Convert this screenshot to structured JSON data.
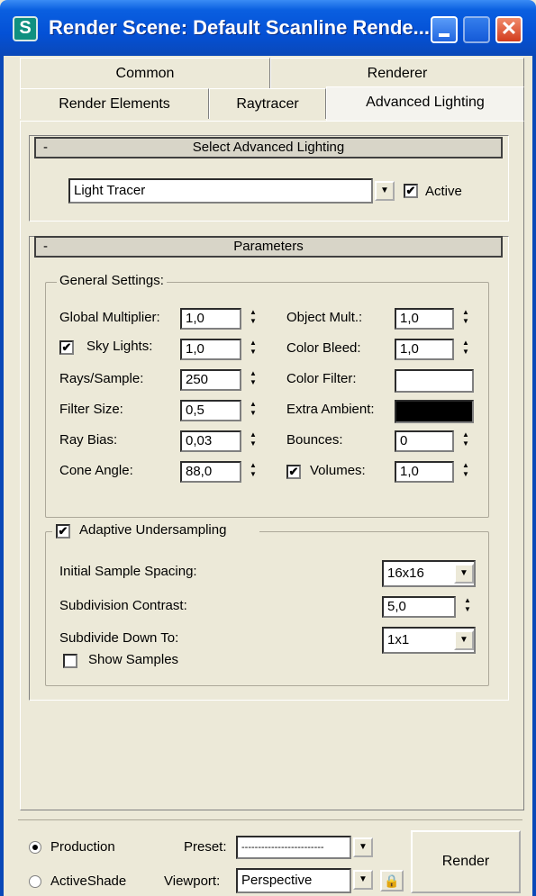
{
  "window": {
    "title": "Render Scene: Default Scanline Rende..."
  },
  "tabs": {
    "row1": [
      "Common",
      "Renderer"
    ],
    "row2": [
      "Render Elements",
      "Raytracer",
      "Advanced Lighting"
    ]
  },
  "select_rollout": {
    "title": "Select Advanced Lighting",
    "collapse": "-",
    "plugin_value": "Light Tracer",
    "active_label": "Active",
    "active_checked": true
  },
  "parameters": {
    "title": "Parameters",
    "collapse": "-",
    "general_title": "General Settings:",
    "global_multiplier": {
      "label": "Global Multiplier:",
      "value": "1,0"
    },
    "sky_lights": {
      "label": "Sky Lights:",
      "value": "1,0",
      "checked": true
    },
    "rays_sample": {
      "label": "Rays/Sample:",
      "value": "250"
    },
    "filter_size": {
      "label": "Filter Size:",
      "value": "0,5"
    },
    "ray_bias": {
      "label": "Ray Bias:",
      "value": "0,03"
    },
    "cone_angle": {
      "label": "Cone Angle:",
      "value": "88,0"
    },
    "object_mult": {
      "label": "Object Mult.:",
      "value": "1,0"
    },
    "color_bleed": {
      "label": "Color Bleed:",
      "value": "1,0"
    },
    "color_filter": {
      "label": "Color Filter:",
      "color": "#ffffff"
    },
    "extra_ambient": {
      "label": "Extra Ambient:",
      "color": "#000000"
    },
    "bounces": {
      "label": "Bounces:",
      "value": "0"
    },
    "volumes": {
      "label": "Volumes:",
      "value": "1,0",
      "checked": true
    }
  },
  "adaptive": {
    "title": "Adaptive Undersampling",
    "checked": true,
    "initial_spacing": {
      "label": "Initial Sample Spacing:",
      "value": "16x16"
    },
    "subdivision_contrast": {
      "label": "Subdivision Contrast:",
      "value": "5,0"
    },
    "subdivide_down": {
      "label": "Subdivide Down To:",
      "value": "1x1"
    },
    "show_samples": {
      "label": "Show Samples",
      "checked": false
    }
  },
  "footer": {
    "production_label": "Production",
    "activeshade_label": "ActiveShade",
    "preset_label": "Preset:",
    "preset_value": "-------------------------",
    "viewport_label": "Viewport:",
    "viewport_value": "Perspective",
    "render_label": "Render"
  },
  "icons": {
    "app": "3dsmax-icon",
    "lock": "lock-icon",
    "close": "close-icon",
    "minimize": "minimize-icon",
    "maximize": "maximize-icon"
  }
}
